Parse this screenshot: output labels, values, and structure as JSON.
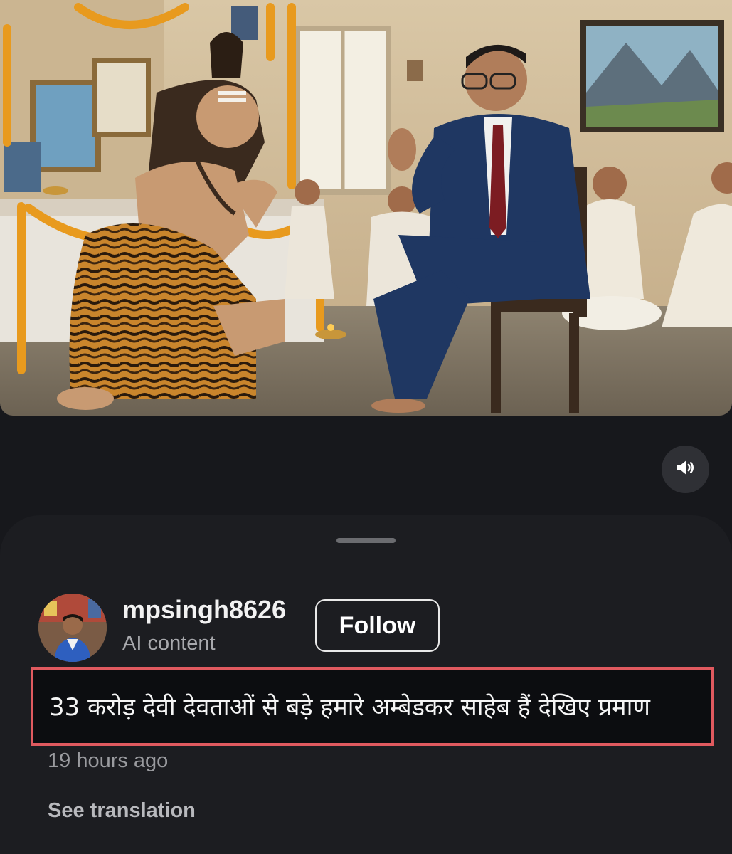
{
  "post": {
    "username": "mpsingh8626",
    "ai_label": "AI content",
    "follow_label": "Follow",
    "caption": "33 करोड़ देवी देवताओं से बड़े हमारे अम्बेडकर साहेब हैं देखिए प्रमाण",
    "timestamp": "19 hours ago",
    "see_translation_label": "See translation"
  },
  "controls": {
    "volume_icon": "speaker-volume-icon"
  },
  "colors": {
    "background": "#17181c",
    "sheet": "#1c1d21",
    "highlight_border": "#e05a5f",
    "text_primary": "#f2f2f2",
    "text_secondary": "#9a9b9f"
  }
}
